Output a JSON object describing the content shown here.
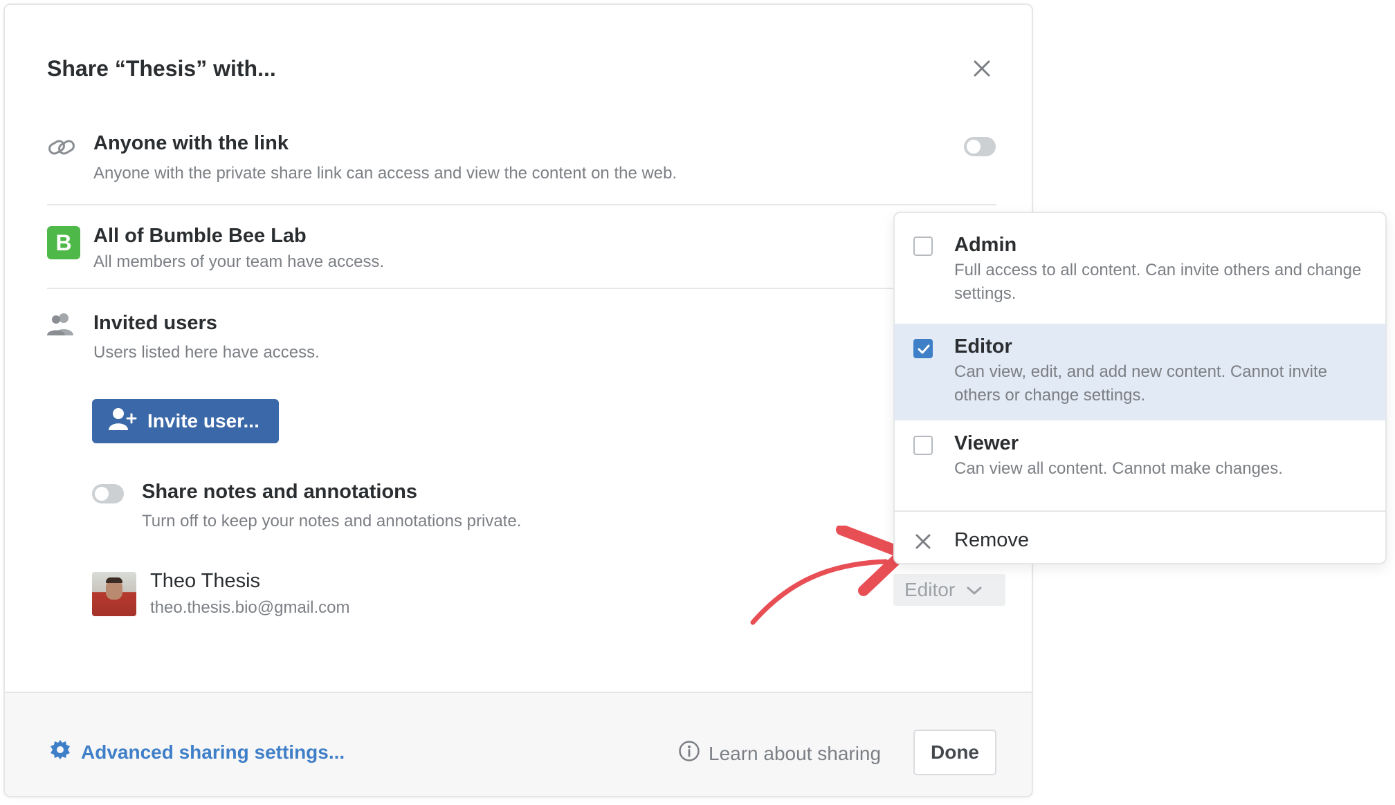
{
  "dialog": {
    "title": "Share “Thesis” with...",
    "close_icon": "close-icon"
  },
  "link_share": {
    "icon": "link-icon",
    "title": "Anyone with the link",
    "description": "Anyone with the private share link can access and view the content on the web.",
    "enabled": false
  },
  "team": {
    "badge_letter": "B",
    "badge_color": "#4eb848",
    "title": "All of Bumble Bee Lab",
    "description": "All members of your team have access."
  },
  "invited": {
    "icon": "users-icon",
    "title": "Invited users",
    "description": "Users listed here have access.",
    "invite_button": "Invite user...",
    "share_notes_title": "Share notes and annotations",
    "share_notes_description": "Turn off to keep your notes and annotations private.",
    "share_notes_enabled": false,
    "users": [
      {
        "name": "Theo Thesis",
        "email": "theo.thesis.bio@gmail.com",
        "role": "Editor"
      }
    ]
  },
  "role_menu": {
    "options": [
      {
        "label": "Admin",
        "description": "Full access to all content. Can invite others and change settings.",
        "checked": false
      },
      {
        "label": "Editor",
        "description": "Can view, edit, and add new content. Cannot invite others or change settings.",
        "checked": true
      },
      {
        "label": "Viewer",
        "description": "Can view all content. Cannot make changes.",
        "checked": false
      }
    ],
    "remove_label": "Remove"
  },
  "footer": {
    "advanced_label": "Advanced sharing settings...",
    "learn_label": "Learn about sharing",
    "done_label": "Done"
  },
  "colors": {
    "primary": "#3b68a8",
    "link": "#3f7fc8",
    "annotation_arrow": "#e84f55"
  }
}
